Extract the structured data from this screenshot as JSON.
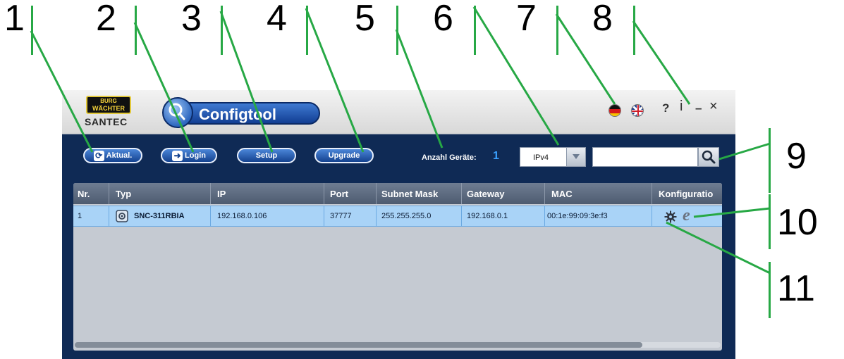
{
  "callouts": [
    "1",
    "2",
    "3",
    "4",
    "5",
    "6",
    "7",
    "8",
    "9",
    "10",
    "11"
  ],
  "logo": {
    "badge_line1": "BURG",
    "badge_line2": "WÄCHTER",
    "sub": "SANTEC"
  },
  "app": {
    "title": "Configtool"
  },
  "window_controls": {
    "help": "?",
    "info": "i",
    "minimize": "–",
    "close": "×"
  },
  "toolbar": {
    "refresh_label": "Aktual.",
    "login_label": "Login",
    "setup_label": "Setup",
    "upgrade_label": "Upgrade",
    "device_count_label": "Anzahl Geräte:",
    "device_count": "1",
    "ip_version": "IPv4",
    "search_value": ""
  },
  "table": {
    "columns": [
      "Nr.",
      "Typ",
      "IP",
      "Port",
      "Subnet Mask",
      "Gateway",
      "MAC",
      "Konfiguratio"
    ],
    "rows": [
      {
        "nr": "1",
        "typ": "SNC-311RBIA",
        "ip": "192.168.0.106",
        "port": "37777",
        "subnet": "255.255.255.0",
        "gateway": "192.168.0.1",
        "mac": "00:1e:99:09:3e:f3"
      }
    ]
  },
  "icons": {
    "refresh": "refresh-icon",
    "login": "login-icon",
    "search": "search-icon",
    "camera": "camera-icon",
    "settings": "gear-icon",
    "browser": "ie-browser-icon",
    "flag_de": "german-flag-icon",
    "flag_uk": "uk-flag-icon"
  },
  "colors": {
    "callout_line": "#27a845",
    "window_bg": "#0f2a55",
    "button": "#1f56b0",
    "selected_row": "#a9d3f7",
    "header": "#5d6b80",
    "count": "#3aa0ff"
  }
}
